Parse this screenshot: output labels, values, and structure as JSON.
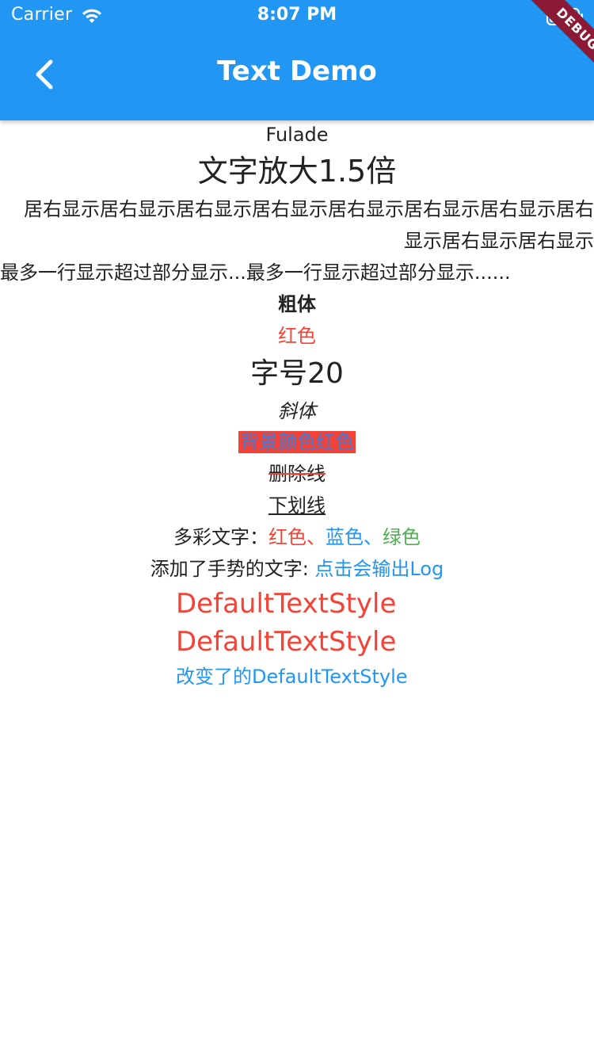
{
  "status_bar": {
    "carrier": "Carrier",
    "time": "8:07 PM",
    "icons": [
      "wifi-icon",
      "battery-icon"
    ]
  },
  "debug_banner": "DEBUG",
  "app_bar": {
    "title": "Text Demo",
    "back_icon": "chevron-left-icon",
    "color": "#2196F3"
  },
  "texts": {
    "fulade": "Fulade",
    "scale": "文字放大1.5倍",
    "align_right": "居右显示居右显示居右显示居右显示居右显示居右显示居右显示居右显示居右显示居右显示",
    "max_lines": "最多一行显示超过部分显示...最多一行显示超过部分显示......",
    "bold": "粗体",
    "red": "红色",
    "font_size": "字号20",
    "italic": "斜体",
    "background": "背景颜色红色",
    "strikethrough": "删除线",
    "underline": "下划线"
  },
  "rich_text": {
    "prefix": "多彩文字：",
    "red": "红色",
    "sep1": "、",
    "blue": "蓝色",
    "sep2": "、",
    "green": "绿色"
  },
  "gesture_text": {
    "prefix": "添加了手势的文字: ",
    "link": "点击会输出Log"
  },
  "default_text_style": {
    "line1": "DefaultTextStyle",
    "line2": "DefaultTextStyle",
    "changed": "改变了的DefaultTextStyle"
  },
  "colors": {
    "primary": "#2196F3",
    "red": "#F44336",
    "green": "#4CAF50"
  }
}
